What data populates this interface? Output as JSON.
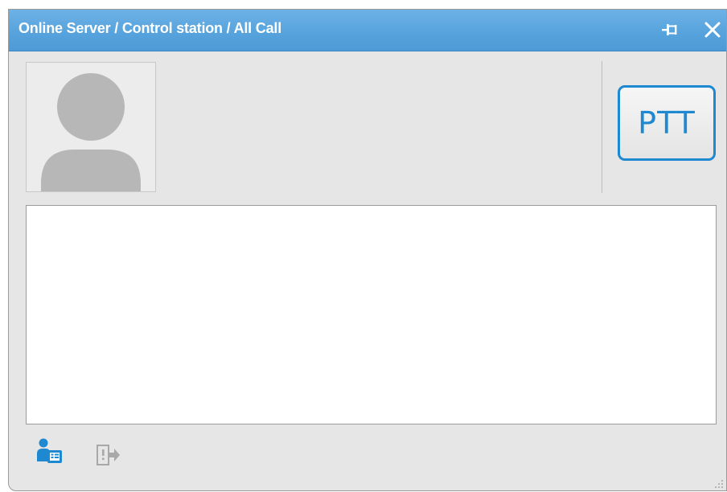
{
  "window": {
    "title": "Online Server / Control station / All Call"
  },
  "titlebar_buttons": [
    {
      "icon": "pin-icon"
    },
    {
      "icon": "close-icon"
    }
  ],
  "ptt": {
    "label": "PTT"
  },
  "message_area": {
    "text": ""
  },
  "toolbar": [
    {
      "icon": "contacts-icon"
    },
    {
      "icon": "exit-icon"
    }
  ],
  "colors": {
    "titlebar": "#56a2dc",
    "accent": "#1e88d0",
    "window_bg": "#e6e6e6"
  }
}
